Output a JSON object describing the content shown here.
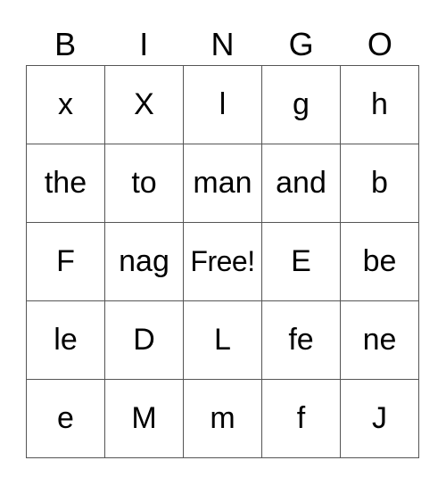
{
  "header": [
    "B",
    "I",
    "N",
    "G",
    "O"
  ],
  "rows": [
    [
      "x",
      "X",
      "l",
      "g",
      "h"
    ],
    [
      "the",
      "to",
      "man",
      "and",
      "b"
    ],
    [
      "F",
      "nag",
      "Free!",
      "E",
      "be"
    ],
    [
      "le",
      "D",
      "L",
      "fe",
      "ne"
    ],
    [
      "e",
      "M",
      "m",
      "f",
      "J"
    ]
  ]
}
